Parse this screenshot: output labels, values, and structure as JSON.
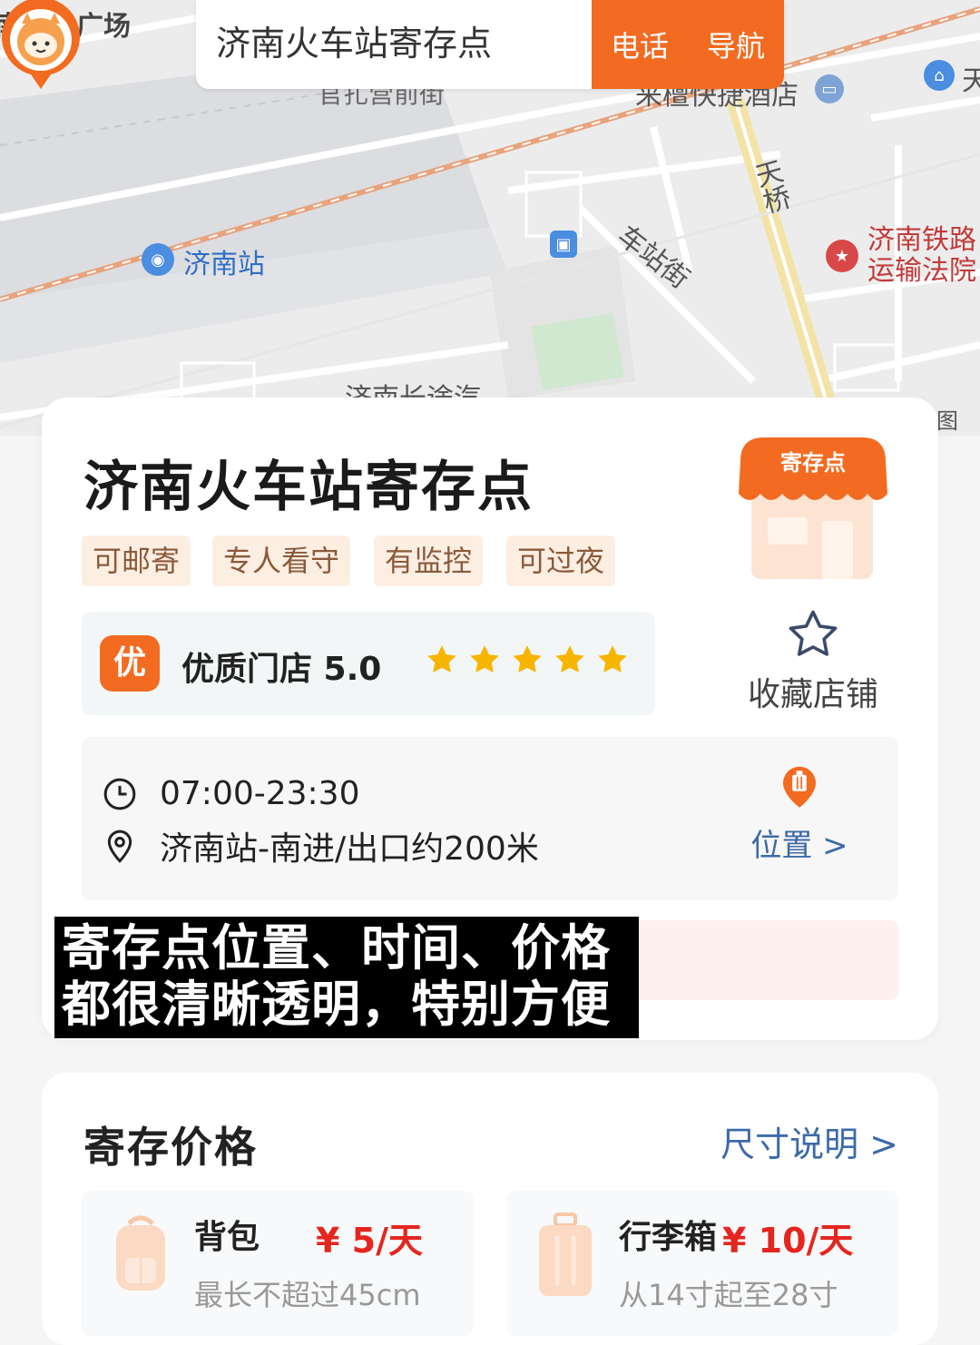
{
  "map": {
    "labels": {
      "north_square": "南站北广场",
      "jinan_station": "济南站",
      "chezhan_street": "车站街",
      "tianqiao": "天桥",
      "court": [
        "济南铁路",
        "运输法院"
      ],
      "hotel": "来檀快捷酒店",
      "top_road": "官扎营前街",
      "bottom_road": "济南长途汽",
      "right_edge": "天",
      "edge_char": "图"
    }
  },
  "topbar": {
    "title": "济南火车站寄存点",
    "call_label": "电话",
    "nav_label": "导航"
  },
  "shop": {
    "name": "济南火车站寄存点",
    "tags": [
      "可邮寄",
      "专人看守",
      "有监控",
      "可过夜"
    ],
    "illustration_label": "寄存点",
    "badge": "优",
    "rating_text": "优质门店 5.0",
    "stars": 5,
    "favorite_label": "收藏店铺",
    "hours": "07:00-23:30",
    "address": "济南站-南进/出口约200米",
    "location_label": "位置 >"
  },
  "caption": {
    "line1": "寄存点位置、时间、价格",
    "line2": "都很清晰透明，特别方便"
  },
  "pricing": {
    "title": "寄存价格",
    "size_link": "尺寸说明 >",
    "items": [
      {
        "name": "背包",
        "price": "¥ 5/天",
        "desc": "最长不超过45cm"
      },
      {
        "name": "行李箱",
        "price": "¥ 10/天",
        "desc": "从14寸起至28寸"
      }
    ]
  },
  "colors": {
    "accent": "#f26b21",
    "price_red": "#e4261f",
    "link_blue": "#3c6aa8",
    "tag_bg": "#fdeee2",
    "star": "#f7b500"
  }
}
